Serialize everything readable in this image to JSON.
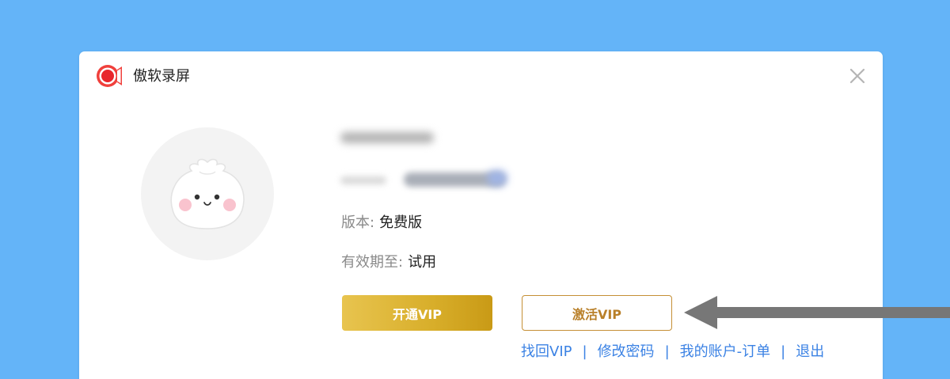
{
  "app": {
    "title": "傲软录屏",
    "logo_icon": "record-camera-logo-icon",
    "close_icon": "close-icon"
  },
  "profile": {
    "avatar_icon": "steamed-bun-avatar-icon",
    "username": "",
    "account": ""
  },
  "info": {
    "version_label": "版本:",
    "version_value": "免费版",
    "expiry_label": "有效期至:",
    "expiry_value": "试用"
  },
  "buttons": {
    "open_vip": "开通VIP",
    "activate_vip": "激活VIP"
  },
  "links": {
    "recover_vip": "找回VIP",
    "separator": "|",
    "change_password": "修改密码",
    "my_account_orders": "我的账户-订单",
    "logout": "退出"
  },
  "colors": {
    "background": "#64b4f8",
    "dialog": "#ffffff",
    "gold_button": "#d8ae2a",
    "activate_border": "#c58f35",
    "activate_text": "#b9802a",
    "link": "#3b82e4",
    "logo_red": "#f0403c",
    "arrow": "#777777"
  },
  "annotation": {
    "arrow_icon": "left-pointing-arrow-icon"
  }
}
